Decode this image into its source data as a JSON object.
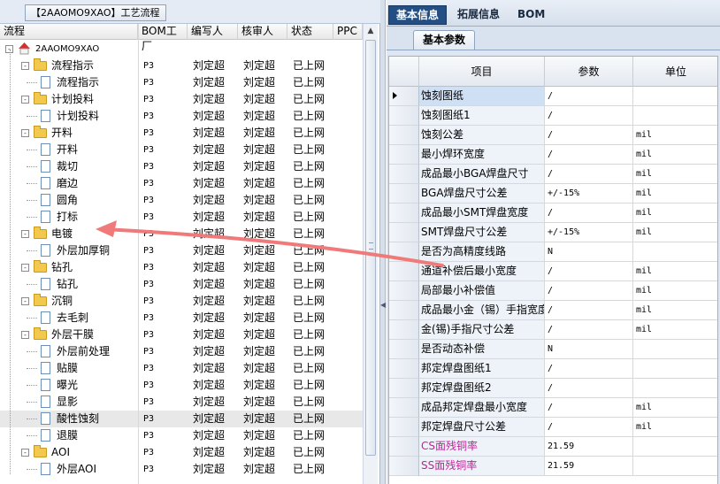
{
  "left": {
    "title": "【2AAOMO9XAO】工艺流程",
    "columns": [
      "流程",
      "BOM工厂",
      "编写人",
      "核审人",
      "状态",
      "PPC"
    ],
    "rows": [
      {
        "level": 0,
        "type": "root",
        "toggle": "-",
        "name": "2AAOMO9XAO",
        "bom": "",
        "writer": "",
        "reviewer": "",
        "status": ""
      },
      {
        "level": 1,
        "type": "folder",
        "toggle": "-",
        "name": "流程指示",
        "bom": "P3",
        "writer": "刘定超",
        "reviewer": "刘定超",
        "status": "已上网"
      },
      {
        "level": 2,
        "type": "doc",
        "toggle": "",
        "name": "流程指示",
        "bom": "P3",
        "writer": "刘定超",
        "reviewer": "刘定超",
        "status": "已上网"
      },
      {
        "level": 1,
        "type": "folder",
        "toggle": "-",
        "name": "计划投料",
        "bom": "P3",
        "writer": "刘定超",
        "reviewer": "刘定超",
        "status": "已上网"
      },
      {
        "level": 2,
        "type": "doc",
        "toggle": "",
        "name": "计划投料",
        "bom": "P3",
        "writer": "刘定超",
        "reviewer": "刘定超",
        "status": "已上网"
      },
      {
        "level": 1,
        "type": "folder",
        "toggle": "-",
        "name": "开料",
        "bom": "P3",
        "writer": "刘定超",
        "reviewer": "刘定超",
        "status": "已上网"
      },
      {
        "level": 2,
        "type": "doc",
        "toggle": "",
        "name": "开料",
        "bom": "P3",
        "writer": "刘定超",
        "reviewer": "刘定超",
        "status": "已上网"
      },
      {
        "level": 2,
        "type": "doc",
        "toggle": "",
        "name": "裁切",
        "bom": "P3",
        "writer": "刘定超",
        "reviewer": "刘定超",
        "status": "已上网"
      },
      {
        "level": 2,
        "type": "doc",
        "toggle": "",
        "name": "磨边",
        "bom": "P3",
        "writer": "刘定超",
        "reviewer": "刘定超",
        "status": "已上网"
      },
      {
        "level": 2,
        "type": "doc",
        "toggle": "",
        "name": "圆角",
        "bom": "P3",
        "writer": "刘定超",
        "reviewer": "刘定超",
        "status": "已上网"
      },
      {
        "level": 2,
        "type": "doc",
        "toggle": "",
        "name": "打标",
        "bom": "P3",
        "writer": "刘定超",
        "reviewer": "刘定超",
        "status": "已上网"
      },
      {
        "level": 1,
        "type": "folder",
        "toggle": "-",
        "name": "电镀",
        "bom": "P3",
        "writer": "刘定超",
        "reviewer": "刘定超",
        "status": "已上网"
      },
      {
        "level": 2,
        "type": "doc",
        "toggle": "",
        "name": "外层加厚铜",
        "bom": "P3",
        "writer": "刘定超",
        "reviewer": "刘定超",
        "status": "已上网"
      },
      {
        "level": 1,
        "type": "folder",
        "toggle": "-",
        "name": "钻孔",
        "bom": "P3",
        "writer": "刘定超",
        "reviewer": "刘定超",
        "status": "已上网"
      },
      {
        "level": 2,
        "type": "doc",
        "toggle": "",
        "name": "钻孔",
        "bom": "P3",
        "writer": "刘定超",
        "reviewer": "刘定超",
        "status": "已上网"
      },
      {
        "level": 1,
        "type": "folder",
        "toggle": "-",
        "name": "沉铜",
        "bom": "P3",
        "writer": "刘定超",
        "reviewer": "刘定超",
        "status": "已上网"
      },
      {
        "level": 2,
        "type": "doc",
        "toggle": "",
        "name": "去毛刺",
        "bom": "P3",
        "writer": "刘定超",
        "reviewer": "刘定超",
        "status": "已上网"
      },
      {
        "level": 1,
        "type": "folder",
        "toggle": "-",
        "name": "外层干膜",
        "bom": "P3",
        "writer": "刘定超",
        "reviewer": "刘定超",
        "status": "已上网"
      },
      {
        "level": 2,
        "type": "doc",
        "toggle": "",
        "name": "外层前处理",
        "bom": "P3",
        "writer": "刘定超",
        "reviewer": "刘定超",
        "status": "已上网"
      },
      {
        "level": 2,
        "type": "doc",
        "toggle": "",
        "name": "贴膜",
        "bom": "P3",
        "writer": "刘定超",
        "reviewer": "刘定超",
        "status": "已上网"
      },
      {
        "level": 2,
        "type": "doc",
        "toggle": "",
        "name": "曝光",
        "bom": "P3",
        "writer": "刘定超",
        "reviewer": "刘定超",
        "status": "已上网"
      },
      {
        "level": 2,
        "type": "doc",
        "toggle": "",
        "name": "显影",
        "bom": "P3",
        "writer": "刘定超",
        "reviewer": "刘定超",
        "status": "已上网"
      },
      {
        "level": 2,
        "type": "doc",
        "toggle": "",
        "name": "酸性蚀刻",
        "bom": "P3",
        "writer": "刘定超",
        "reviewer": "刘定超",
        "status": "已上网",
        "selected": true
      },
      {
        "level": 2,
        "type": "doc",
        "toggle": "",
        "name": "退膜",
        "bom": "P3",
        "writer": "刘定超",
        "reviewer": "刘定超",
        "status": "已上网"
      },
      {
        "level": 1,
        "type": "folder",
        "toggle": "-",
        "name": "AOI",
        "bom": "P3",
        "writer": "刘定超",
        "reviewer": "刘定超",
        "status": "已上网"
      },
      {
        "level": 2,
        "type": "doc",
        "toggle": "",
        "name": "外层AOI",
        "bom": "P3",
        "writer": "刘定超",
        "reviewer": "刘定超",
        "status": "已上网"
      }
    ]
  },
  "right": {
    "tabs": [
      "基本信息",
      "拓展信息",
      "BOM"
    ],
    "subtab": "基本参数",
    "columns": [
      "项目",
      "参数",
      "单位"
    ],
    "rows": [
      {
        "item": "蚀刻图纸",
        "param": "/",
        "unit": "",
        "current": true
      },
      {
        "item": "蚀刻图纸1",
        "param": "/",
        "unit": ""
      },
      {
        "item": "蚀刻公差",
        "param": "/",
        "unit": "mil"
      },
      {
        "item": "最小焊环宽度",
        "param": "/",
        "unit": "mil"
      },
      {
        "item": "成品最小BGA焊盘尺寸",
        "param": "/",
        "unit": "mil"
      },
      {
        "item": "BGA焊盘尺寸公差",
        "param": "+/-15%",
        "unit": "mil"
      },
      {
        "item": "成品最小SMT焊盘宽度",
        "param": "/",
        "unit": "mil"
      },
      {
        "item": "SMT焊盘尺寸公差",
        "param": "+/-15%",
        "unit": "mil"
      },
      {
        "item": "是否为高精度线路",
        "param": "N",
        "unit": ""
      },
      {
        "item": "通道补偿后最小宽度",
        "param": "/",
        "unit": "mil"
      },
      {
        "item": "局部最小补偿值",
        "param": "/",
        "unit": "mil"
      },
      {
        "item": "成品最小金（锡）手指宽度",
        "param": "/",
        "unit": "mil"
      },
      {
        "item": "金(锡)手指尺寸公差",
        "param": "/",
        "unit": "mil"
      },
      {
        "item": "是否动态补偿",
        "param": "N",
        "unit": ""
      },
      {
        "item": "邦定焊盘图纸1",
        "param": "/",
        "unit": ""
      },
      {
        "item": "邦定焊盘图纸2",
        "param": "/",
        "unit": ""
      },
      {
        "item": "成品邦定焊盘最小宽度",
        "param": "/",
        "unit": "mil"
      },
      {
        "item": "邦定焊盘尺寸公差",
        "param": "/",
        "unit": "mil"
      },
      {
        "item": "CS面残铜率",
        "param": "21.59",
        "unit": "",
        "pink": true
      },
      {
        "item": "SS面残铜率",
        "param": "21.59",
        "unit": "",
        "pink": true
      }
    ]
  },
  "colors": {
    "accent_tab": "#244f84",
    "arrow": "#f07a7a",
    "pink_text": "#c5209b"
  }
}
